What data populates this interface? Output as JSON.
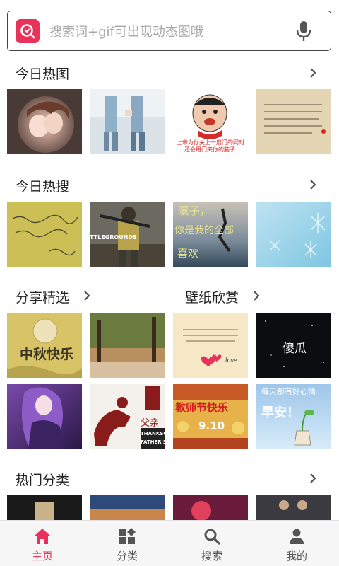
{
  "search": {
    "placeholder": "搜索词+gif可出现动态图哦",
    "logo_icon": "app-logo-icon",
    "voice_icon": "microphone-icon"
  },
  "sections": {
    "today_hot_images": {
      "title": "今日热图"
    },
    "today_hot_search": {
      "title": "今日热搜"
    },
    "share_picks": {
      "title": "分享精选"
    },
    "wallpapers": {
      "title": "壁纸欣赏"
    },
    "hot_categories": {
      "title": "热门分类"
    }
  },
  "thumb_texts": {
    "meme_caption_line1": "上帝为你关上一扇门的同时",
    "meme_caption_line2": "还会用门夹你的脑子",
    "battlegrounds": "TTLEGROUNDS",
    "mooncake": "中秋快乐",
    "silly": "傻瓜",
    "father": "父亲",
    "father_big": "THANKSGI",
    "father_big2": "FATHER'S",
    "teachers_day": "教师节快乐",
    "teachers_date": "9.10",
    "good_morning": "早安！",
    "good_morning_top": "每天都有好心情",
    "poem_1": "囊子，",
    "poem_2": "你是我的全部",
    "poem_3": "喜欢",
    "love": "love"
  },
  "tabs": [
    {
      "label": "主页",
      "icon": "home-icon",
      "active": true
    },
    {
      "label": "分类",
      "icon": "category-grid-icon",
      "active": false
    },
    {
      "label": "搜索",
      "icon": "search-icon",
      "active": false
    },
    {
      "label": "我的",
      "icon": "user-icon",
      "active": false
    }
  ],
  "colors": {
    "accent": "#e8325a",
    "tab_active": "#e8325a",
    "tab_inactive": "#555555"
  }
}
